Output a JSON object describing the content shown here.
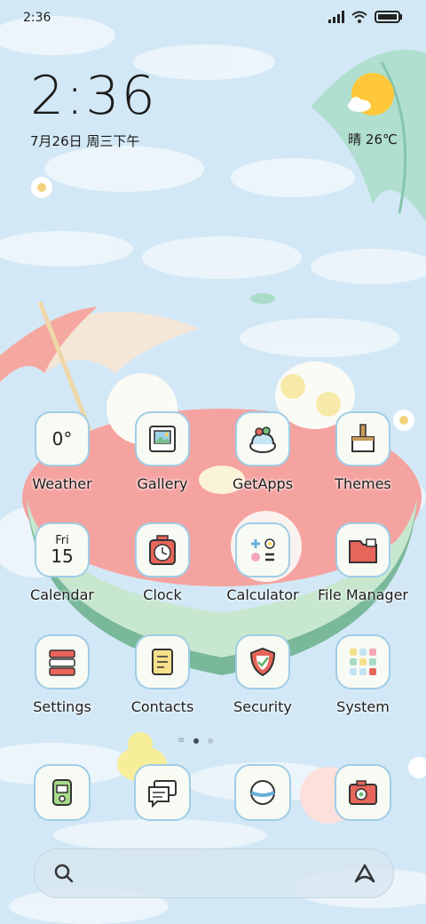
{
  "status_bar": {
    "time": "2:36",
    "icons": [
      "signal-icon",
      "wifi-icon",
      "battery-icon"
    ]
  },
  "clock_widget": {
    "time": "2:36",
    "date": "7月26日 周三下午"
  },
  "weather_widget": {
    "icon": "sun-icon",
    "condition_temp": "晴 26℃"
  },
  "apps": [
    {
      "name": "weather",
      "label": "Weather",
      "icon": "weather-icon",
      "value": "0°"
    },
    {
      "name": "gallery",
      "label": "Gallery",
      "icon": "gallery-icon"
    },
    {
      "name": "getapps",
      "label": "GetApps",
      "icon": "getapps-icon"
    },
    {
      "name": "themes",
      "label": "Themes",
      "icon": "themes-icon"
    },
    {
      "name": "calendar",
      "label": "Calendar",
      "icon": "calendar-icon",
      "weekday": "Fri",
      "day": "15"
    },
    {
      "name": "clock",
      "label": "Clock",
      "icon": "clock-icon"
    },
    {
      "name": "calculator",
      "label": "Calculator",
      "icon": "calculator-icon"
    },
    {
      "name": "file-manager",
      "label": "File Manager",
      "icon": "folder-icon"
    },
    {
      "name": "settings",
      "label": "Settings",
      "icon": "settings-icon"
    },
    {
      "name": "contacts",
      "label": "Contacts",
      "icon": "contacts-icon"
    },
    {
      "name": "security",
      "label": "Security",
      "icon": "shield-icon"
    },
    {
      "name": "system",
      "label": "System",
      "icon": "folder-grid-icon"
    }
  ],
  "page_indicator": {
    "pages": 2,
    "current": 1
  },
  "dock": [
    {
      "name": "phone",
      "icon": "phone-icon"
    },
    {
      "name": "messages",
      "icon": "messages-icon"
    },
    {
      "name": "browser",
      "icon": "browser-icon"
    },
    {
      "name": "camera",
      "icon": "camera-icon"
    }
  ],
  "search_bar": {
    "icon": "search-icon",
    "assistant_icon": "assistant-icon"
  }
}
